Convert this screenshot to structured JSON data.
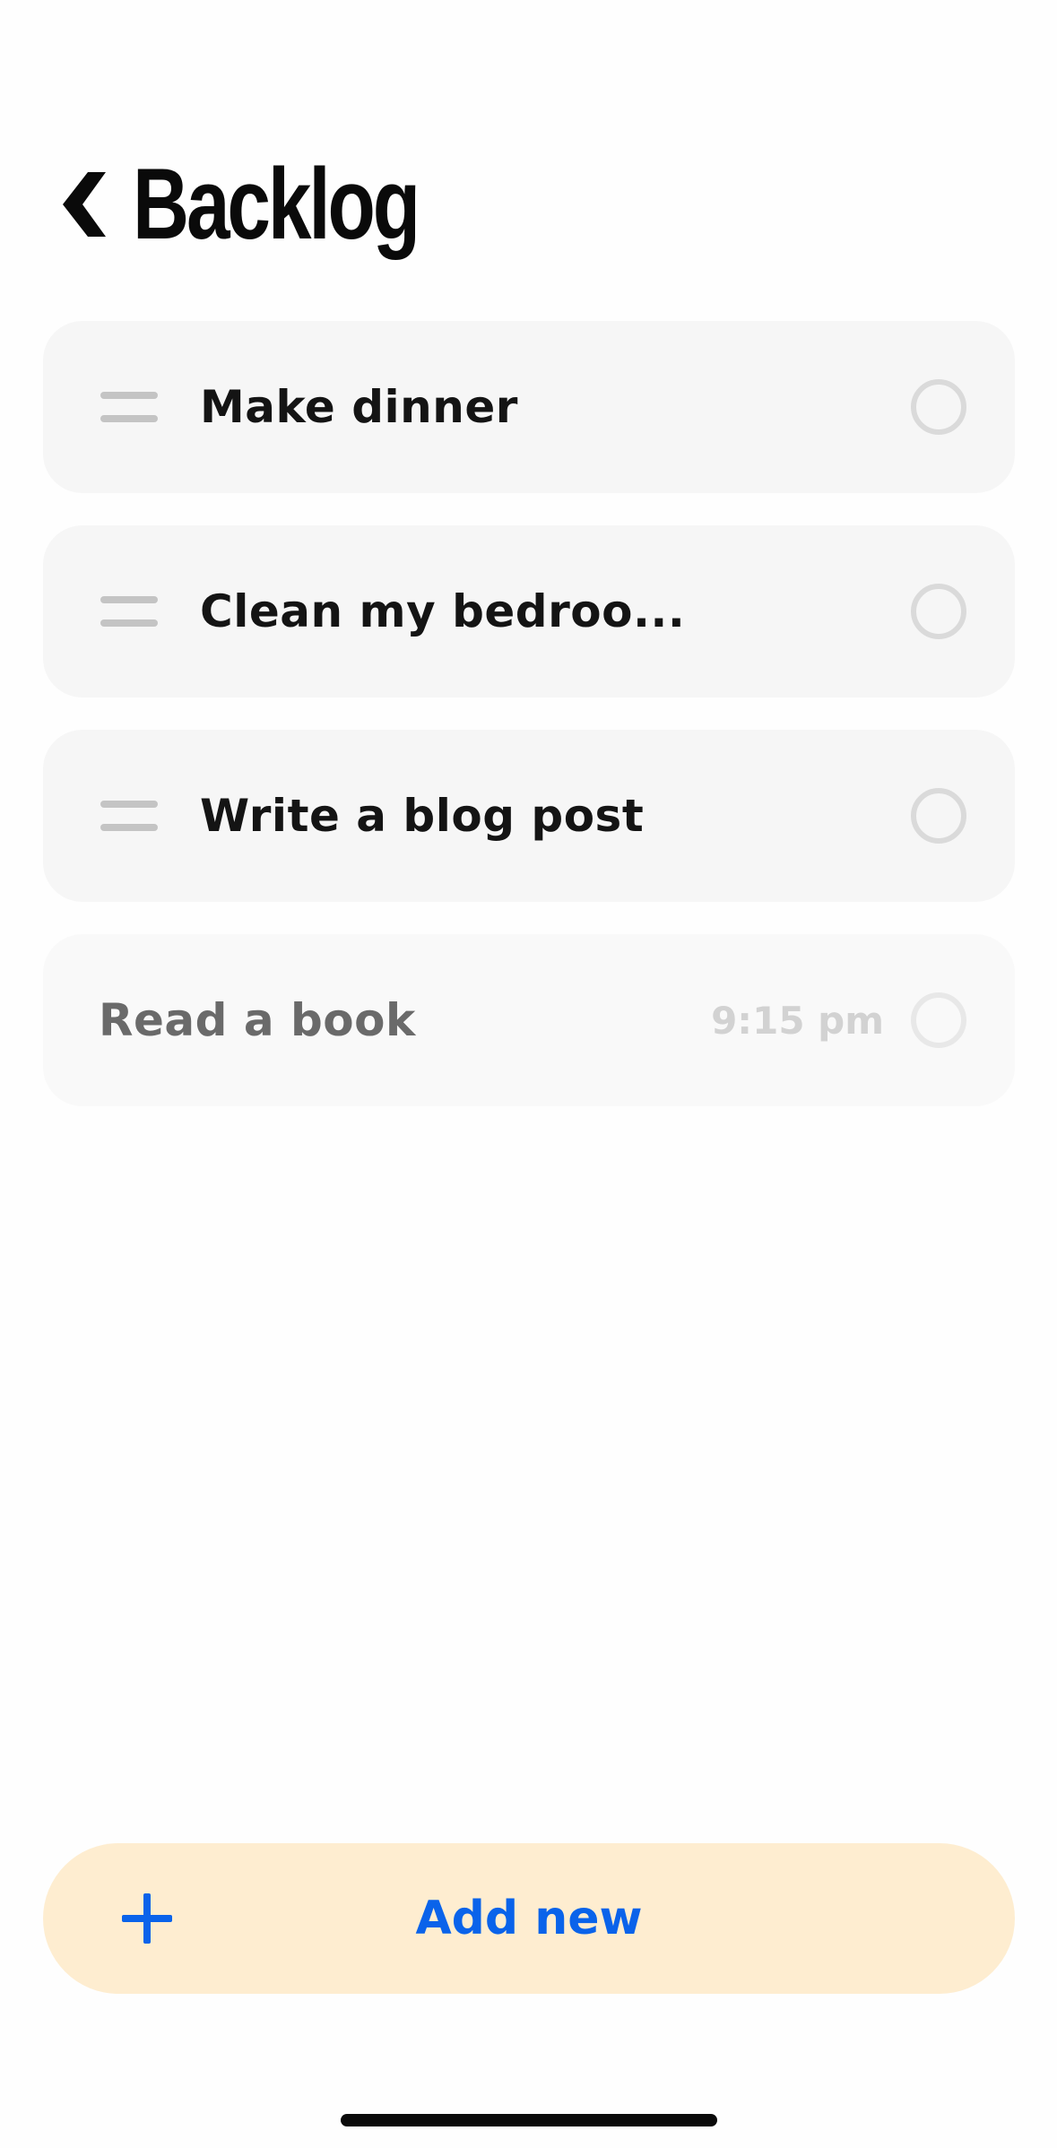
{
  "header": {
    "title": "Backlog",
    "back_icon": "chevron-left-icon"
  },
  "tasks": [
    {
      "label": "Make dinner",
      "time": "",
      "draggable": true,
      "faded": false
    },
    {
      "label": "Clean my bedroo...",
      "time": "",
      "draggable": true,
      "faded": false
    },
    {
      "label": "Write a blog post",
      "time": "",
      "draggable": true,
      "faded": false
    },
    {
      "label": "Read a book",
      "time": "9:15 pm",
      "draggable": false,
      "faded": true
    }
  ],
  "add_button": {
    "label": "Add new",
    "icon": "plus-icon"
  },
  "colors": {
    "background": "#fefefe",
    "card": "#f6f6f6",
    "accent": "#0a63ea",
    "add_button_bg": "#feedd0"
  }
}
